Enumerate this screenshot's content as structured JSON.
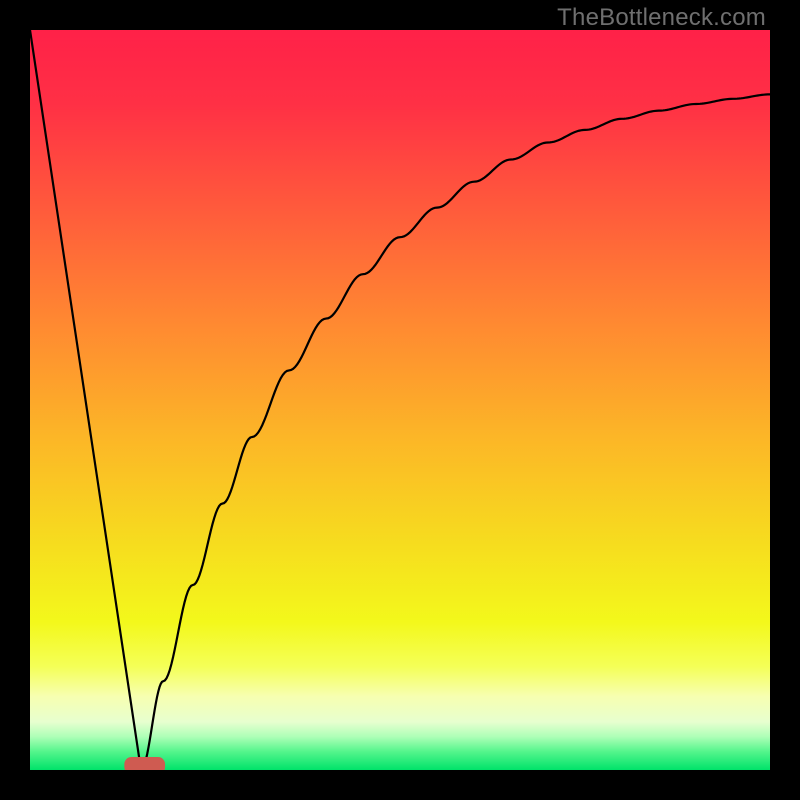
{
  "watermark": "TheBottleneck.com",
  "gradient_stops": [
    {
      "offset": 0.0,
      "color": "#ff2148"
    },
    {
      "offset": 0.1,
      "color": "#ff3045"
    },
    {
      "offset": 0.25,
      "color": "#ff5d3b"
    },
    {
      "offset": 0.4,
      "color": "#ff8a31"
    },
    {
      "offset": 0.55,
      "color": "#fcb627"
    },
    {
      "offset": 0.7,
      "color": "#f6de1e"
    },
    {
      "offset": 0.8,
      "color": "#f3f81b"
    },
    {
      "offset": 0.86,
      "color": "#f4ff57"
    },
    {
      "offset": 0.9,
      "color": "#f7ffb0"
    },
    {
      "offset": 0.935,
      "color": "#e7ffcf"
    },
    {
      "offset": 0.955,
      "color": "#aeffb7"
    },
    {
      "offset": 0.975,
      "color": "#55f58c"
    },
    {
      "offset": 1.0,
      "color": "#00e36a"
    }
  ],
  "chart_data": {
    "type": "line",
    "title": "",
    "xlabel": "",
    "ylabel": "",
    "xlim": [
      0,
      100
    ],
    "ylim": [
      0,
      100
    ],
    "notes": "Bottleneck-style chart. x is a normalized performance axis (0–100), y is bottleneck percentage (0–100). Left black curve: near-linear descent from (0,100) to minimum near x≈15. Right black curve: monotone-increasing saturating curve from the minimum toward ~90 at x=100. Red rounded marker at the shared minimum (y≈0).",
    "series": [
      {
        "name": "left-branch",
        "x": [
          0,
          3,
          6,
          9,
          12,
          15
        ],
        "values": [
          100,
          80,
          60,
          40,
          20,
          0
        ]
      },
      {
        "name": "right-branch",
        "x": [
          15,
          18,
          22,
          26,
          30,
          35,
          40,
          45,
          50,
          55,
          60,
          65,
          70,
          75,
          80,
          85,
          90,
          95,
          100
        ],
        "values": [
          0,
          12,
          25,
          36,
          45,
          54,
          61,
          67,
          72,
          76,
          79.5,
          82.5,
          84.8,
          86.5,
          88,
          89.1,
          90,
          90.7,
          91.3
        ]
      }
    ],
    "marker": {
      "x": 15.5,
      "y": 0.6,
      "w": 5.5,
      "h": 2.3,
      "color": "#cf5b51"
    }
  }
}
